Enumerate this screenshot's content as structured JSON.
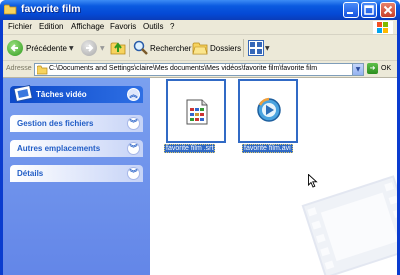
{
  "window": {
    "title": "favorite film"
  },
  "titlebar_buttons": [
    "minimize",
    "maximize",
    "close"
  ],
  "menu": {
    "items": [
      "Fichier",
      "Edition",
      "Affichage",
      "Favoris",
      "Outils",
      "?"
    ]
  },
  "toolbar": {
    "back_label": "Précédente",
    "search_label": "Rechercher",
    "folders_label": "Dossiers"
  },
  "address": {
    "label": "Adresse",
    "value": "C:\\Documents and Settings\\claire\\Mes documents\\Mes vidéos\\favorite film\\favorite film",
    "go_label": "OK"
  },
  "sidebar": {
    "panels": [
      {
        "title": "Tâches vidéo",
        "icon": "film-icon"
      },
      {
        "title": "Gestion des fichiers"
      },
      {
        "title": "Autres emplacements"
      },
      {
        "title": "Détails"
      }
    ]
  },
  "files": [
    {
      "name": "favorite film .srt",
      "icon": "subtitle-file-icon",
      "selected": true
    },
    {
      "name": "favorite film.avi",
      "icon": "media-player-icon",
      "selected": true
    }
  ],
  "colors": {
    "titlebar": "#0a5ae0",
    "sidebar": "#6f94ec",
    "selection": "#316ac5",
    "panel_title": "#215dc6"
  }
}
